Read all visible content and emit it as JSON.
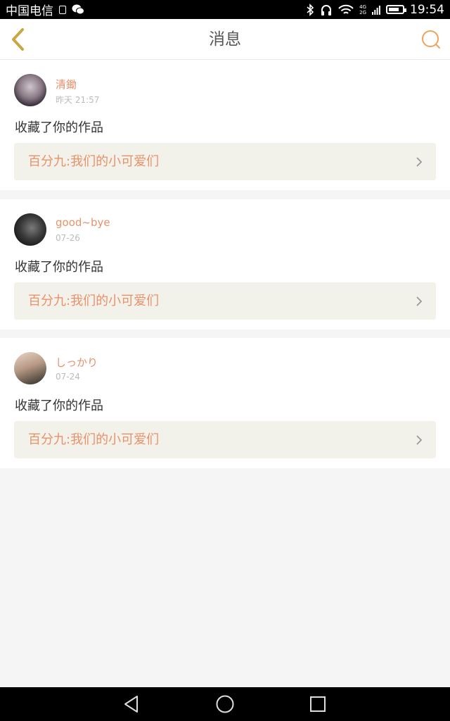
{
  "status_bar": {
    "carrier": "中国电信",
    "network_top": "4G",
    "network_bottom": "2G",
    "time": "19:54",
    "battery_percent": 80,
    "icons": [
      "sim-card-icon",
      "wechat-icon",
      "bluetooth-icon",
      "headphones-icon",
      "wifi-icon",
      "signal-icon",
      "battery-icon"
    ]
  },
  "header": {
    "title": "消息",
    "back_icon": "chevron-left-icon",
    "search_icon": "search-icon"
  },
  "messages": [
    {
      "username": "清鋤",
      "time": "昨天 21:57",
      "action": "收藏了你的作品",
      "work_title": "百分九:我们的小可爱们"
    },
    {
      "username": "good~bye",
      "time": "07-26",
      "action": "收藏了你的作品",
      "work_title": "百分九:我们的小可爱们"
    },
    {
      "username": "しっかり",
      "time": "07-24",
      "action": "收藏了你的作品",
      "work_title": "百分九:我们的小可爱们"
    }
  ],
  "nav_bar": {
    "icons": [
      "back-triangle-icon",
      "home-circle-icon",
      "recents-square-icon"
    ]
  },
  "colors": {
    "accent": "#e8916a",
    "back_icon": "#c9a646",
    "link_bg": "#f3f2ea",
    "page_bg": "#f5f5f5"
  }
}
